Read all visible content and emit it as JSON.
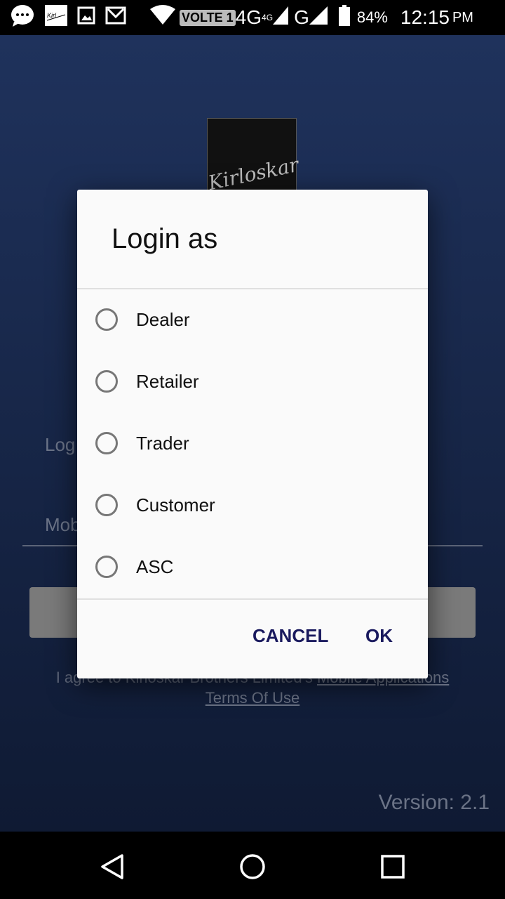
{
  "status_bar": {
    "icons": [
      "messages-icon",
      "kirloskar-app-icon",
      "gallery-icon",
      "gmail-icon",
      "wifi-icon"
    ],
    "volte": "VOLTE 1",
    "network1": "4G",
    "network1_sup": "4G",
    "network2": "G",
    "battery": "84%",
    "time": "12:15",
    "ampm": "PM"
  },
  "background": {
    "logo_text": "Kirloskar",
    "login_label": "Log",
    "mobile_label": "Mob",
    "agree_text": "I agree to Kirloskar Brothers Limited's ",
    "agree_link1": "Mobile Applications",
    "agree_link2": "Terms Of Use",
    "version": "Version: 2.1"
  },
  "dialog": {
    "title": "Login as",
    "options": [
      {
        "label": "Dealer",
        "selected": false
      },
      {
        "label": "Retailer",
        "selected": false
      },
      {
        "label": "Trader",
        "selected": false
      },
      {
        "label": "Customer",
        "selected": false
      },
      {
        "label": "ASC",
        "selected": false
      }
    ],
    "cancel": "CANCEL",
    "ok": "OK",
    "accent": "#1a1a5e"
  },
  "nav_bar": {
    "icons": [
      "back-icon",
      "home-icon",
      "recents-icon"
    ]
  }
}
